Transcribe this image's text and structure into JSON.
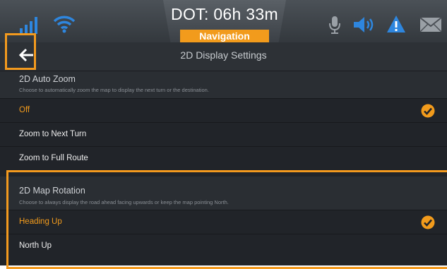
{
  "status": {
    "dot": "DOT: 06h 33m",
    "mode": "Navigation"
  },
  "icons": {
    "signal": "signal-strength-icon",
    "wifi": "wifi-icon",
    "mic": "microphone-icon",
    "speaker": "speaker-icon",
    "alert": "alert-triangle-icon",
    "mail": "mail-envelope-icon",
    "back": "back-arrow-icon",
    "check": "checkmark-circle-icon"
  },
  "colors": {
    "accent": "#f29b1c",
    "background": "#212429",
    "highlight": "#f39a1e"
  },
  "title": "2D Display Settings",
  "auto_zoom": {
    "title": "2D Auto Zoom",
    "description": "Choose to automatically zoom the map to display the next turn or the destination.",
    "options": [
      {
        "label": "Off",
        "selected": true
      },
      {
        "label": "Zoom to Next Turn",
        "selected": false
      },
      {
        "label": "Zoom to Full Route",
        "selected": false
      }
    ]
  },
  "map_rotation": {
    "title": "2D Map Rotation",
    "description": "Choose to always display the road ahead facing upwards or keep the map pointing North.",
    "options": [
      {
        "label": "Heading Up",
        "selected": true
      },
      {
        "label": "North Up",
        "selected": false
      }
    ]
  }
}
